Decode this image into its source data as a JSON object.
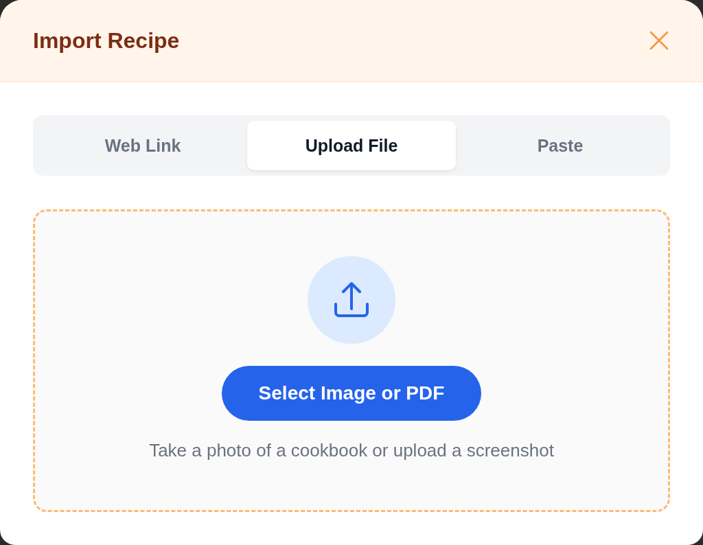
{
  "dialog": {
    "title": "Import Recipe"
  },
  "tabs": [
    {
      "label": "Web Link",
      "selected": false
    },
    {
      "label": "Upload File",
      "selected": true
    },
    {
      "label": "Paste",
      "selected": false
    }
  ],
  "upload": {
    "button": "Select Image or PDF",
    "hint": "Take a photo of a cookbook or upload a screenshot"
  }
}
